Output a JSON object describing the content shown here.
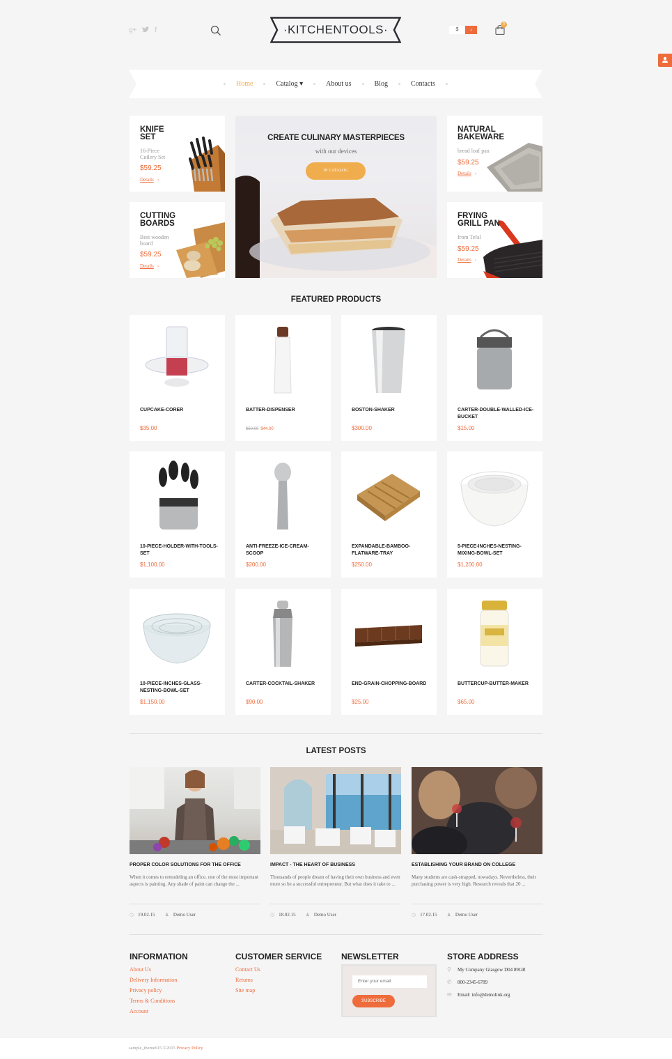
{
  "header": {
    "social": [
      "g+",
      "twitter",
      "f"
    ],
    "logo": "·KITCHENTOOLS·",
    "currency": "$",
    "cart_count": "0"
  },
  "nav": {
    "items": [
      {
        "label": "Home",
        "active": true
      },
      {
        "label": "Catalog ▾",
        "active": false
      },
      {
        "label": "About us",
        "active": false
      },
      {
        "label": "Blog",
        "active": false
      },
      {
        "label": "Contacts",
        "active": false
      }
    ]
  },
  "promos": [
    {
      "title": "KNIFE SET",
      "subtitle": "16-Piece Cutlery Set",
      "price": "$59.25",
      "details": "Details"
    },
    {
      "title": "CUTTING BOARDS",
      "subtitle": "Best wooden board",
      "price": "$59.25",
      "details": "Details"
    },
    {
      "title": "NATURAL BAKEWARE",
      "subtitle": "bread loaf pan",
      "price": "$59.25",
      "details": "Details"
    },
    {
      "title": "FRYING GRILL PAN",
      "subtitle": "from Tefal",
      "price": "$59.25",
      "details": "Details"
    }
  ],
  "hero": {
    "title": "CREATE CULINARY MASTERPIECES",
    "subtitle": "with our devices",
    "button": "IN CATALOG"
  },
  "featured": {
    "title": "FEATURED PRODUCTS",
    "products": [
      {
        "name": "CUPCAKE-CORER",
        "price": "$35.00"
      },
      {
        "name": "BATTER-DISPENSER",
        "old_price": "$50.00",
        "price": "$44.00"
      },
      {
        "name": "BOSTON-SHAKER",
        "price": "$300.00"
      },
      {
        "name": "CARTER-DOUBLE-WALLED-ICE-BUCKET",
        "price": "$15.00"
      },
      {
        "name": "10-PIECE-HOLDER-WITH-TOOLS-SET",
        "price": "$1,100.00"
      },
      {
        "name": "ANTI-FREEZE-ICE-CREAM-SCOOP",
        "price": "$200.00"
      },
      {
        "name": "EXPANDABLE-BAMBOO-FLATWARE-TRAY",
        "price": "$250.00"
      },
      {
        "name": "5-PIECE-INCHES-NESTING-MIXING-BOWL-SET",
        "price": "$1,200.00"
      },
      {
        "name": "10-PIECE-INCHES-GLASS-NESTING-BOWL-SET",
        "price": "$1,150.00"
      },
      {
        "name": "CARTER-COCKTAIL-SHAKER",
        "price": "$90.00"
      },
      {
        "name": "END-GRAIN-CHOPPING-BOARD",
        "price": "$25.00"
      },
      {
        "name": "BUTTERCUP-BUTTER-MAKER",
        "price": "$65.00"
      }
    ]
  },
  "posts": {
    "title": "LATEST POSTS",
    "items": [
      {
        "title": "PROPER COLOR SOLUTIONS FOR THE OFFICE",
        "excerpt": "When it comes to remodeling an office, one of the most important aspects is painting. Any shade of paint can change the ...",
        "date": "19.02.15",
        "author": "Demo User"
      },
      {
        "title": "IMPACT - THE HEART OF BUSINESS",
        "excerpt": "Thousands of people dream of having their own business and even more so be a successful entrepreneur. But what does it take to ...",
        "date": "18.02.15",
        "author": "Demo User"
      },
      {
        "title": "ESTABLISHING YOUR BRAND ON COLLEGE",
        "excerpt": "Many students are cash-strapped, nowadays. Nevertheless, their purchasing power is very high. Research reveals that 20 ...",
        "date": "17.02.15",
        "author": "Demo User"
      }
    ]
  },
  "footer": {
    "information": {
      "title": "INFORMATION",
      "links": [
        "About Us",
        "Delivery Information",
        "Privacy policy",
        "Terms & Conditions",
        "Account"
      ]
    },
    "customer_service": {
      "title": "CUSTOMER SERVICE",
      "links": [
        "Contact Us",
        "Returns",
        "Site map"
      ]
    },
    "newsletter": {
      "title": "NEWSLETTER",
      "placeholder": "Enter your email",
      "button": "SUBSCRIBE"
    },
    "store": {
      "title": "STORE ADDRESS",
      "address": "My Company Glasgow D04 89GR",
      "phone": "800-2345-6789",
      "email": "Email: info@demolink.org"
    },
    "copyright": "sample_theme615 ©2015",
    "privacy": "Privacy Policy"
  },
  "colors": {
    "accent": "#ee6b3b",
    "highlight": "#f0ad4e",
    "background": "#f5f5f5"
  }
}
